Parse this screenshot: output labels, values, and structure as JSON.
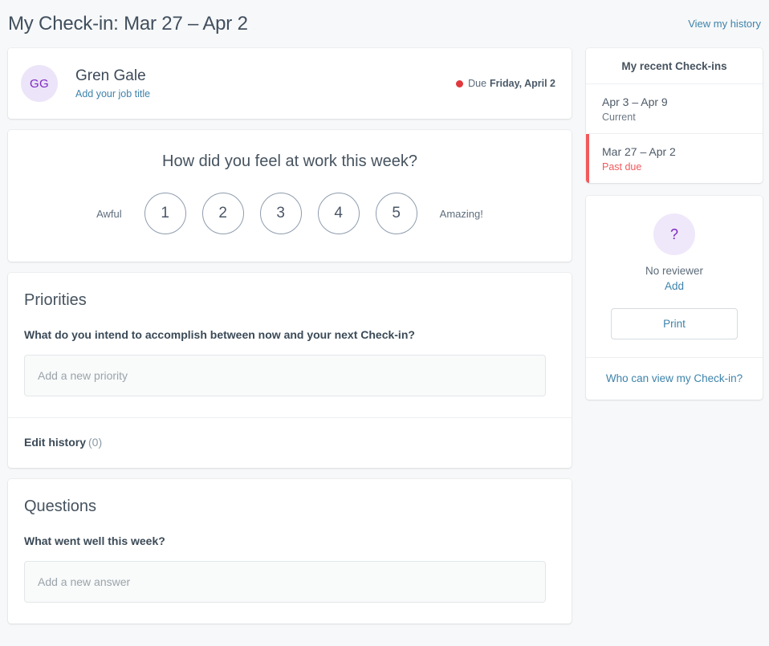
{
  "header": {
    "title": "My Check-in: Mar 27 – Apr 2",
    "history_link": "View my history"
  },
  "user_card": {
    "avatar_initials": "GG",
    "name": "Gren Gale",
    "job_title_link": "Add your job title",
    "due_label": "Due",
    "due_date": "Friday, April 2",
    "due_dot_color": "#e0383c"
  },
  "mood": {
    "question": "How did you feel at work this week?",
    "low_label": "Awful",
    "high_label": "Amazing!",
    "options": [
      "1",
      "2",
      "3",
      "4",
      "5"
    ]
  },
  "priorities": {
    "title": "Priorities",
    "prompt": "What do you intend to accomplish between now and your next Check-in?",
    "input_placeholder": "Add a new priority",
    "input_value": "",
    "edit_history_label": "Edit history",
    "edit_history_count": "(0)"
  },
  "questions": {
    "title": "Questions",
    "prompt": "What went well this week?",
    "input_placeholder": "Add a new answer",
    "input_value": ""
  },
  "sidebar": {
    "recent_title": "My recent Check-ins",
    "checkins": [
      {
        "range": "Apr 3 – Apr 9",
        "status": "Current",
        "past_due": false
      },
      {
        "range": "Mar 27 – Apr 2",
        "status": "Past due",
        "past_due": true
      }
    ],
    "reviewer": {
      "avatar_glyph": "?",
      "label": "No reviewer",
      "add_link": "Add",
      "print_button": "Print"
    },
    "visibility_link": "Who can view my Check-in?"
  },
  "colors": {
    "link": "#3d83ab",
    "danger": "#f2595c",
    "due_dot": "#e0383c",
    "avatar_bg": "#ece4f8",
    "avatar_fg": "#7d29c4",
    "page_bg": "#f7f8f9"
  }
}
